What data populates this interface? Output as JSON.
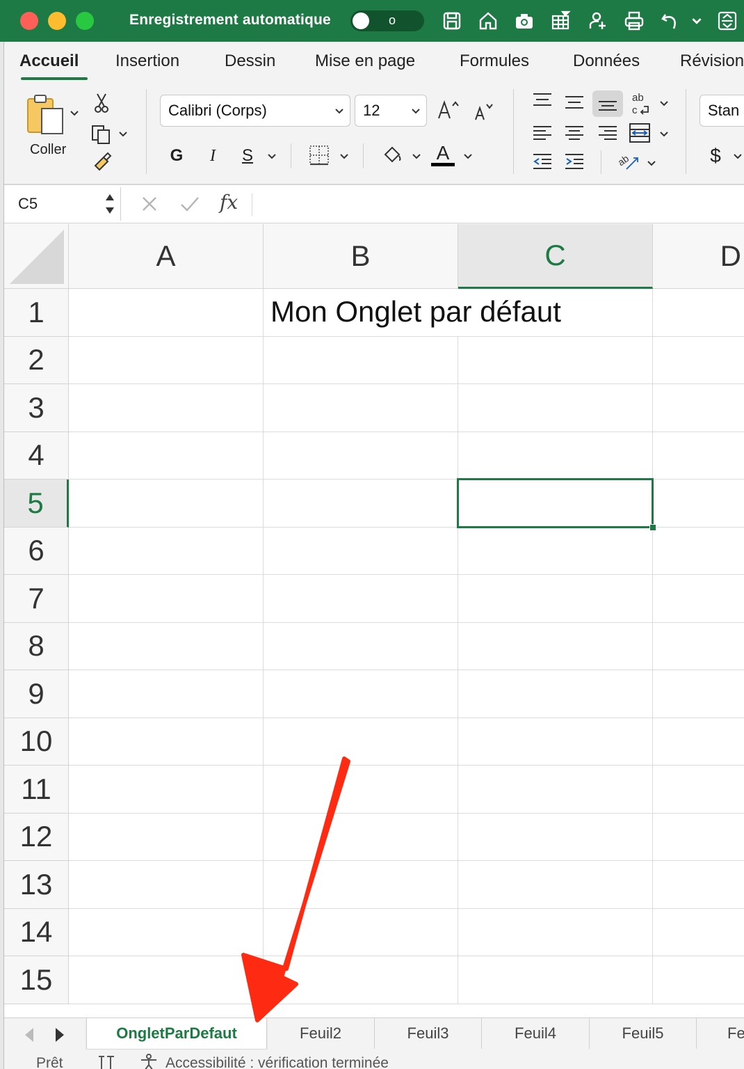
{
  "titlebar": {
    "autosave_label": "Enregistrement automatique",
    "autosave_state": "o",
    "icons": [
      "save-icon",
      "home-icon",
      "camera-icon",
      "table-icon",
      "share-icon",
      "print-icon",
      "undo-icon",
      "more-icon"
    ]
  },
  "ribbon_tabs": [
    "Accueil",
    "Insertion",
    "Dessin",
    "Mise en page",
    "Formules",
    "Données",
    "Révision"
  ],
  "ribbon": {
    "paste_label": "Coller",
    "font_name": "Calibri (Corps)",
    "font_size": "12",
    "bold": "G",
    "italic": "I",
    "underline": "S",
    "font_color_letter": "A",
    "number_format": "Stan",
    "currency": "$"
  },
  "formula_bar": {
    "name_box": "C5",
    "fx_label": "fx",
    "formula": ""
  },
  "grid": {
    "columns": [
      "A",
      "B",
      "C"
    ],
    "partial_column": "D",
    "selected_column": "C",
    "rows": [
      "1",
      "2",
      "3",
      "4",
      "5",
      "6",
      "7",
      "8",
      "9",
      "10",
      "11",
      "12",
      "13",
      "14",
      "15"
    ],
    "selected_row": "5",
    "cell_B1": "Mon Onglet par défaut",
    "active_cell": "C5"
  },
  "sheet_tabs": [
    "OngletParDefaut",
    "Feuil2",
    "Feuil3",
    "Feuil4",
    "Feuil5",
    "Fe"
  ],
  "active_sheet": "OngletParDefaut",
  "status_bar": {
    "ready": "Prêt",
    "accessibility": "Accessibilité : vérification terminée"
  },
  "colors": {
    "excel_green": "#1e7a44",
    "arrow_red": "#ff2a12"
  }
}
